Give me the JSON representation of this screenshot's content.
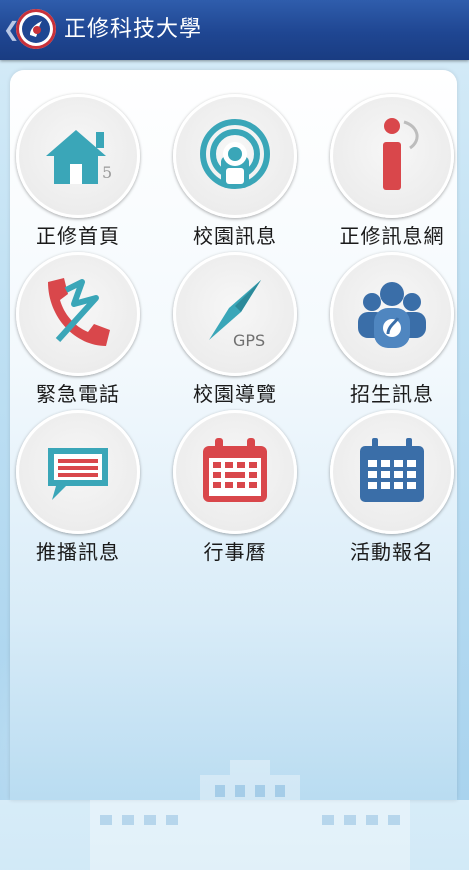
{
  "header": {
    "back_glyph": "❮",
    "title": "正修科技大學",
    "logo_icon": "university-logo-icon"
  },
  "colors": {
    "header": "#1f4692",
    "teal": "#3aa6b8",
    "red": "#d9474b",
    "navy": "#3a6ea8"
  },
  "menu": [
    {
      "label": "正修首頁",
      "icon": "home-icon"
    },
    {
      "label": "校園訊息",
      "icon": "broadcast-icon"
    },
    {
      "label": "正修訊息網",
      "icon": "info-icon"
    },
    {
      "label": "緊急電話",
      "icon": "phone-icon"
    },
    {
      "label": "校園導覽",
      "icon": "gps-compass-icon",
      "icon_text": "GPS"
    },
    {
      "label": "招生訊息",
      "icon": "people-icon"
    },
    {
      "label": "推播訊息",
      "icon": "chat-message-icon"
    },
    {
      "label": "行事曆",
      "icon": "calendar-icon"
    },
    {
      "label": "活動報名",
      "icon": "event-calendar-icon"
    }
  ]
}
